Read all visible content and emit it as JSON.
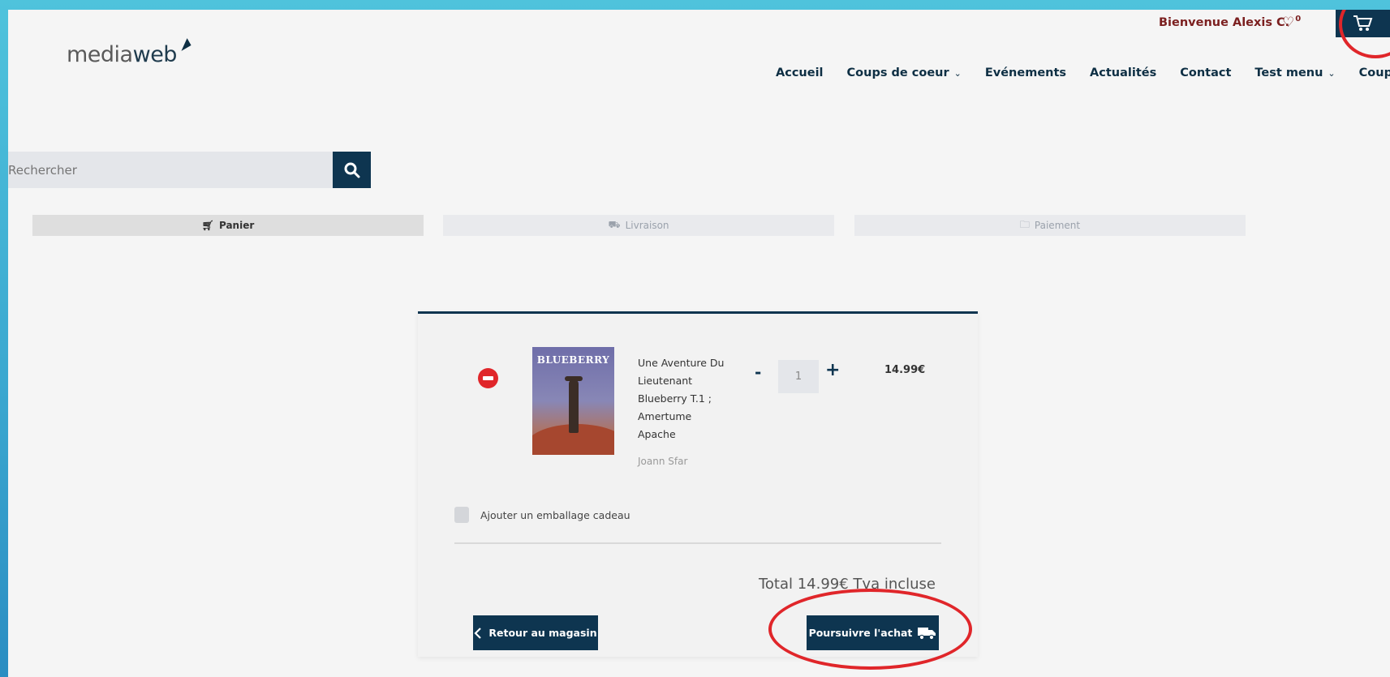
{
  "brand": {
    "logo_plain": "media",
    "logo_strong": "web"
  },
  "topbar": {
    "welcome": "Bienvenue Alexis C.",
    "favorites_count": "0"
  },
  "nav": {
    "items": [
      {
        "label": "Accueil",
        "dropdown": false
      },
      {
        "label": "Coups de coeur",
        "dropdown": true
      },
      {
        "label": "Evénements",
        "dropdown": false
      },
      {
        "label": "Actualités",
        "dropdown": false
      },
      {
        "label": "Contact",
        "dropdown": false
      },
      {
        "label": "Test menu",
        "dropdown": true
      },
      {
        "label": "Coups de coeur",
        "dropdown": true
      }
    ]
  },
  "search": {
    "placeholder": "Rechercher"
  },
  "steps": [
    {
      "label": "Panier",
      "icon": "cart-icon",
      "active": true
    },
    {
      "label": "Livraison",
      "icon": "truck-icon",
      "active": false
    },
    {
      "label": "Paiement",
      "icon": "folder-icon",
      "active": false
    }
  ],
  "cart": {
    "item": {
      "cover_title": "BLUEBERRY",
      "title": "Une Aventure Du Lieutenant Blueberry T.1 ; Amertume Apache",
      "author": "Joann Sfar",
      "quantity": "1",
      "price": "14.99€"
    },
    "gift_label": "Ajouter un emballage cadeau",
    "total": "Total 14.99€ Tva incluse",
    "back_label": "Retour au magasin",
    "next_label": "Poursuivre l'achat"
  },
  "colors": {
    "primary": "#0e3550",
    "accent_red": "#e0262a",
    "welcome_text": "#7b1f1f"
  }
}
